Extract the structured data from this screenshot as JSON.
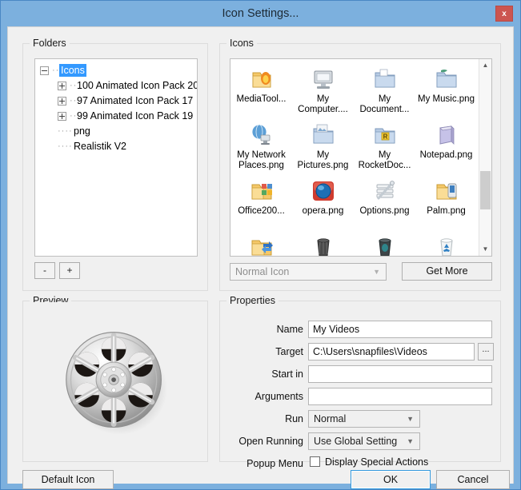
{
  "window": {
    "title": "Icon Settings...",
    "close_label": "x",
    "accent_blue": "#7cb0de",
    "close_red": "#cc5550",
    "selection_blue": "#3399ff"
  },
  "folders_panel": {
    "title": "Folders",
    "tree": [
      {
        "label": "Icons",
        "expander": "minus",
        "depth": 0,
        "selected": true
      },
      {
        "label": "100 Animated Icon Pack  20",
        "expander": "plus",
        "depth": 1,
        "selected": false
      },
      {
        "label": "97 Animated Icon Pack  17",
        "expander": "plus",
        "depth": 1,
        "selected": false
      },
      {
        "label": "99 Animated Icon Pack  19",
        "expander": "plus",
        "depth": 1,
        "selected": false
      },
      {
        "label": "png",
        "expander": "none",
        "depth": 1,
        "selected": false
      },
      {
        "label": "Realistik V2",
        "expander": "none",
        "depth": 1,
        "selected": false
      }
    ],
    "remove_button": "-",
    "add_button": "+"
  },
  "icons_panel": {
    "title": "Icons",
    "items": [
      {
        "caption": "MediaTool...",
        "icon": "folder-flame-icon"
      },
      {
        "caption": "My Computer....",
        "icon": "my-computer-icon"
      },
      {
        "caption": "My Document...",
        "icon": "folder-documents-icon"
      },
      {
        "caption": "My Music.png",
        "icon": "folder-music-icon"
      },
      {
        "caption": "My Network Places.png",
        "icon": "network-globe-icon"
      },
      {
        "caption": "My Pictures.png",
        "icon": "folder-pictures-icon"
      },
      {
        "caption": "My RocketDoc...",
        "caption_icon": "folder-rocketdock-icon",
        "icon": "folder-rocketdock-icon"
      },
      {
        "caption": "Notepad.png",
        "icon": "notepad-icon"
      },
      {
        "caption": "Office200...",
        "icon": "folder-office-icon"
      },
      {
        "caption": "opera.png",
        "icon": "opera-icon"
      },
      {
        "caption": "Options.png",
        "icon": "options-sliders-icon"
      },
      {
        "caption": "Palm.png",
        "icon": "folder-palm-icon"
      },
      {
        "caption": "",
        "icon": "folder-refresh-icon"
      },
      {
        "caption": "",
        "icon": "trash-dark-icon"
      },
      {
        "caption": "",
        "icon": "trash-teal-icon"
      },
      {
        "caption": "",
        "icon": "recycle-bin-icon"
      }
    ],
    "icon_type_select": "Normal Icon",
    "get_more_button": "Get More",
    "scrollbar_up": "▲",
    "scrollbar_down": "▼"
  },
  "preview_panel": {
    "title": "Preview",
    "image_name": "film-reel-icon"
  },
  "properties_panel": {
    "title": "Properties",
    "fields": [
      {
        "label": "Name",
        "value": "My Videos"
      },
      {
        "label": "Target",
        "value": "C:\\Users\\snapfiles\\Videos"
      },
      {
        "label": "Start in",
        "value": ""
      },
      {
        "label": "Arguments",
        "value": ""
      }
    ],
    "browse_button": "...",
    "run_label": "Run",
    "run_value": "Normal",
    "open_running_label": "Open Running",
    "open_running_value": "Use Global Setting",
    "popup_menu_label": "Popup Menu",
    "display_special_actions": "Display Special Actions",
    "special_actions_checked": false,
    "caret": "⌵"
  },
  "footer": {
    "default_icon_button": "Default Icon",
    "ok_button": "OK",
    "cancel_button": "Cancel"
  }
}
